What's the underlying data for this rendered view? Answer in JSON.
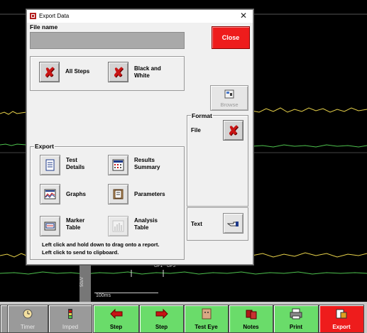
{
  "dialog": {
    "title": "Export Data",
    "close_glyph": "✕",
    "file_name_label": "File name",
    "file_name_value": "",
    "close_button": "Close",
    "all_steps_label": "All Steps",
    "black_white_label": "Black and\nWhite",
    "browse_label": "Browse",
    "format_label": "Format",
    "file_label": "File",
    "export_label": "Export",
    "export_items": {
      "test_details": "Test\nDetails",
      "results_summary": "Results\nSummary",
      "graphs": "Graphs",
      "parameters": "Parameters",
      "marker_table": "Marker\nTable",
      "analysis_table": "Analysis\nTable"
    },
    "text_label": "Text",
    "hint_line1": "Left click and hold down to drag onto a report.",
    "hint_line2": "Left click to send to clipboard."
  },
  "background": {
    "time_scale": "100ms",
    "volt_scale": "50uV",
    "marker_op1": "OP1",
    "marker_op3": "OP3"
  },
  "toolbar": {
    "timer": "Timer",
    "imped": "Imped",
    "step_prev": "Step",
    "step_next": "Step",
    "test_eye": "Test Eye",
    "notes": "Notes",
    "print": "Print",
    "export": "Export"
  },
  "colors": {
    "close_red": "#ee1c1c",
    "toolbar_green": "#6adc6a",
    "trace_yellow": "#e8d24a",
    "trace_green": "#4ec24e"
  }
}
